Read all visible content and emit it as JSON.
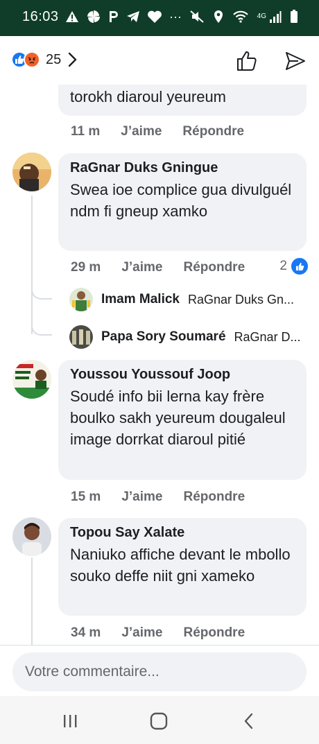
{
  "status_bar": {
    "time": "16:03",
    "left_icons": [
      "warning-icon",
      "pinwheel-icon",
      "parking-icon",
      "telegram-icon",
      "heart-icon",
      "more-icon"
    ],
    "more_label": "···",
    "network_label": "4G"
  },
  "top_bar": {
    "reaction_count": "25",
    "reactions": [
      "like",
      "angry"
    ]
  },
  "comments": [
    {
      "id": "c0",
      "author": "",
      "text": "torokh diaroul yeureum",
      "time": "11 m",
      "like_label": "J’aime",
      "reply_label": "Répondre"
    },
    {
      "id": "c1",
      "author": "RaGnar Duks Gningue",
      "text": "Swea ioe complice gua divulguél ndm fi gneup xamko",
      "time": "29 m",
      "like_label": "J’aime",
      "reply_label": "Répondre",
      "like_count": "2",
      "replies": [
        {
          "author": "Imam Malick",
          "preview": "RaGnar Duks Gn..."
        },
        {
          "author": "Papa Sory Soumaré",
          "preview": "RaGnar D..."
        }
      ]
    },
    {
      "id": "c2",
      "author": "Youssou Youssouf Joop",
      "text": "Soudé info bii lerna kay frère boulko sakh yeureum dougaleul image dorrkat diaroul pitié",
      "time": "15 m",
      "like_label": "J’aime",
      "reply_label": "Répondre"
    },
    {
      "id": "c3",
      "author": "Topou Say Xalate",
      "text": "Naniuko affiche devant le mbollo souko deffe niit gni xameko",
      "time": "34 m",
      "like_label": "J’aime",
      "reply_label": "Répondre"
    }
  ],
  "composer": {
    "placeholder": "Votre commentaire..."
  },
  "colors": {
    "status_bar": "#0f3d2a",
    "like_blue": "#1877f2",
    "angry_orange": "#f0622a",
    "bubble": "#f0f2f5",
    "meta_gray": "#65676b"
  }
}
